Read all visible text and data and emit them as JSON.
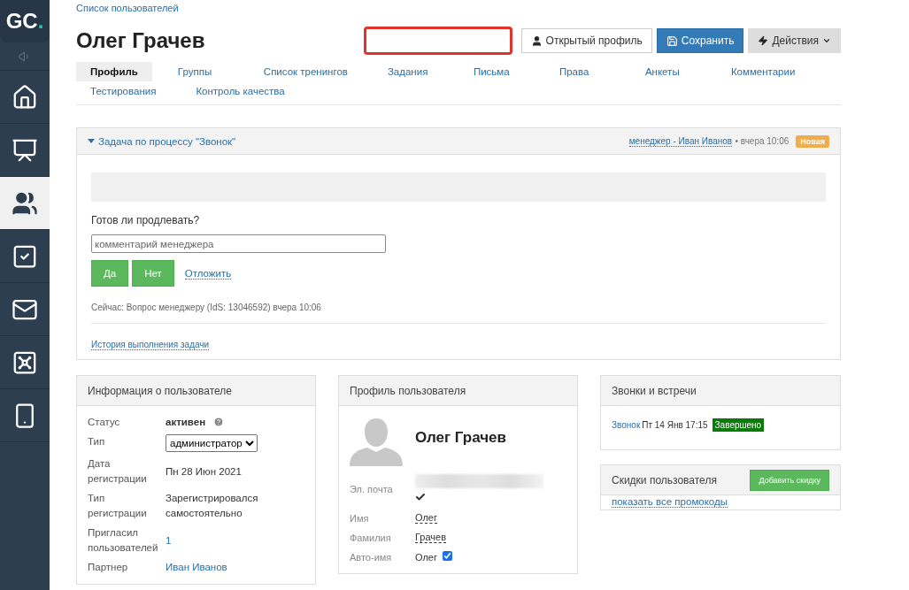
{
  "sidebar": {
    "logo": {
      "letters": "GC",
      "dot": "."
    },
    "items": [
      {
        "kind": "speaker",
        "selected": false
      },
      {
        "kind": "home",
        "selected": false
      },
      {
        "kind": "chart",
        "selected": false
      },
      {
        "kind": "users",
        "selected": true
      },
      {
        "kind": "tasks",
        "selected": false
      },
      {
        "kind": "mail",
        "selected": false
      },
      {
        "kind": "safe",
        "selected": false
      },
      {
        "kind": "phone",
        "selected": false
      }
    ]
  },
  "breadcrumb": "Список пользователей",
  "title": "Олег Грачев",
  "header_buttons": [
    {
      "kind": "profile",
      "label": "Открытый профиль"
    },
    {
      "kind": "save",
      "label": "Сохранить"
    },
    {
      "kind": "actions",
      "label": "Действия"
    }
  ],
  "tabs": [
    {
      "label": "Профиль",
      "selected": true
    },
    {
      "label": "Группы",
      "selected": false
    },
    {
      "label": "Список тренингов",
      "selected": false
    },
    {
      "label": "Задания",
      "selected": false
    },
    {
      "label": "Письма",
      "selected": false
    },
    {
      "label": "Права",
      "selected": false
    },
    {
      "label": "Анкеты",
      "selected": false
    },
    {
      "label": "Комментарии",
      "selected": false
    },
    {
      "label": "Тестирования",
      "selected": false
    },
    {
      "label": "Контроль качества",
      "selected": false
    }
  ],
  "task": {
    "title": "Задача по процессу \"Звонок\"",
    "expanded": true,
    "assignee": "менеджер - Иван Иванов",
    "time": "• вчера 10:06",
    "badge": "Новая",
    "question": "Готов ли продлевать?",
    "comment_placeholder": "комментарий менеджера",
    "buttons": [
      "Да",
      "Нет"
    ],
    "postpone": "Отложить",
    "status": "Сейчас: Вопрос менеджеру (IdS: 13046592) вчера 10:06",
    "history": "История выполнения задачи"
  },
  "user_info": {
    "title": "Информация о пользователе",
    "rows": [
      {
        "kind": "status",
        "label": "Статус",
        "value": "активен"
      },
      {
        "kind": "select",
        "label": "Тип",
        "value": "администратор"
      },
      {
        "kind": "text",
        "label": "Дата регистрации",
        "value": "Пн 28 Июн 2021"
      },
      {
        "kind": "text",
        "label": "Тип регистрации",
        "value": "Зарегистрировался самостоятельно"
      },
      {
        "kind": "link",
        "label": "Пригласил пользователей",
        "value": "1"
      },
      {
        "kind": "link",
        "label": "Партнер",
        "value": "Иван Иванов"
      }
    ]
  },
  "profile": {
    "title": "Профиль пользователя",
    "name": "Олег Грачев",
    "rows": [
      {
        "kind": "email",
        "label": "Эл. почта",
        "verified": true
      },
      {
        "kind": "editable",
        "label": "Имя",
        "value": "Олег"
      },
      {
        "kind": "editable",
        "label": "Фамилия",
        "value": "Грачев"
      },
      {
        "kind": "auto",
        "label": "Авто-имя",
        "value": "Олег",
        "checked": true
      }
    ]
  },
  "calls": {
    "title": "Звонки и встречи",
    "items": [
      {
        "label": "Звонок",
        "date": "Пт 14 Янв 17:15",
        "status": "Завершено"
      }
    ]
  },
  "discounts": {
    "title": "Скидки пользователя",
    "add_button": "Добавить скидку",
    "link": "показать все промокоды"
  }
}
